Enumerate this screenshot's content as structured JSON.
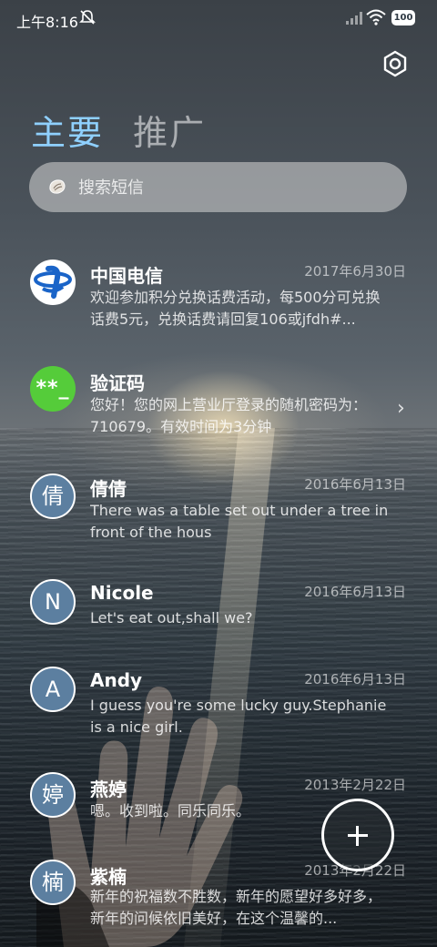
{
  "status_bar": {
    "time": "上午8:16",
    "battery": "100"
  },
  "tabs": [
    {
      "label": "主要"
    },
    {
      "label": "推广"
    }
  ],
  "search": {
    "placeholder": "搜索短信"
  },
  "conversations": [
    {
      "name": "中国电信",
      "date": "2017年6月30日",
      "preview": "欢迎参加积分兑换话费活动，每500分可兑换话费5元，兑换话费请回复106或jfdh#...",
      "avatar_type": "china-telecom-logo"
    },
    {
      "name": "验证码",
      "date": "",
      "preview": "您好！您的网上营业厅登录的随机密码为：710679。有效时间为3分钟",
      "avatar_text": "**_",
      "avatar_color": "#55cc3a"
    },
    {
      "name": "倩倩",
      "date": "2016年6月13日",
      "preview": "There was a table set out under a tree in front of the hous",
      "avatar_text": "倩"
    },
    {
      "name": "Nicole",
      "date": "2016年6月13日",
      "preview": "Let's eat out,shall we?",
      "avatar_text": "N"
    },
    {
      "name": "Andy",
      "date": "2016年6月13日",
      "preview": "I guess you're some lucky guy.Stephanie is a nice girl.",
      "avatar_text": "A"
    },
    {
      "name": "燕婷",
      "date": "2013年2月22日",
      "preview": "嗯。收到啦。同乐同乐。",
      "avatar_text": "婷"
    },
    {
      "name": "紫楠",
      "date": "2013年2月22日",
      "preview": "新年的祝福数不胜数，新年的愿望好多好多，新年的问候依旧美好，在这个温馨的...",
      "avatar_text": "楠"
    }
  ],
  "colors": {
    "accent": "#8fd0ff",
    "avatar_letter_bg": "#5c7fa0"
  }
}
